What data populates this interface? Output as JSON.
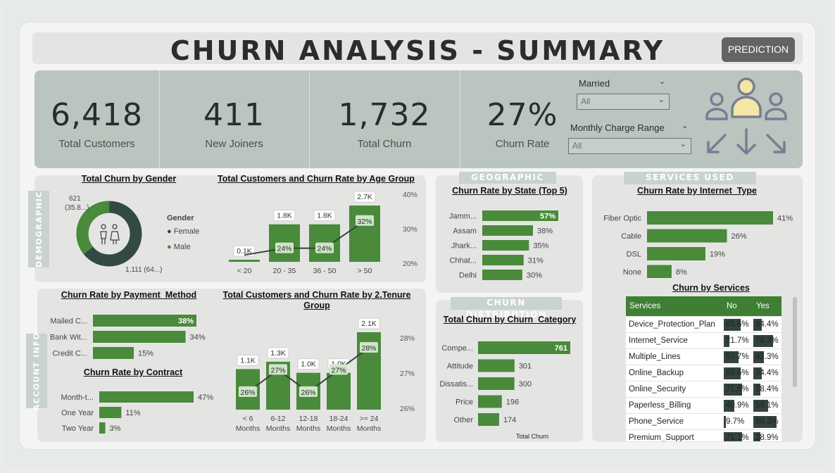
{
  "header": {
    "title": "CHURN ANALYSIS - SUMMARY",
    "prediction_label": "PREDICTION"
  },
  "kpis": [
    {
      "value": "6,418",
      "label": "Total Customers"
    },
    {
      "value": "411",
      "label": "New Joiners"
    },
    {
      "value": "1,732",
      "label": "Total Churn"
    },
    {
      "value": "27%",
      "label": "Churn Rate"
    }
  ],
  "slicers": {
    "married": {
      "label": "Married",
      "value": "All"
    },
    "charge": {
      "label": "Monthly Charge Range",
      "value": "All"
    }
  },
  "sections": {
    "demographic": "DEMOGRAPHIC",
    "account": "ACCOUNT INFO",
    "geographic": "GEOGRAPHIC",
    "distribution": "CHURN DISTRIBUTION",
    "services": "SERVICES USED"
  },
  "gender": {
    "title": "Total Churn by Gender",
    "legend_title": "Gender",
    "female_label": "Female",
    "male_label": "Male",
    "female_data_label": "1,111 (64...)",
    "male_data_label_1": "621",
    "male_data_label_2": "(35.8...)",
    "female_color": "#334a44",
    "male_color": "#4a8a3b"
  },
  "chart_data": [
    {
      "type": "pie",
      "title": "Total Churn by Gender",
      "legend": [
        "Female",
        "Male"
      ],
      "values": [
        1111,
        621
      ],
      "percent": [
        64.2,
        35.8
      ]
    },
    {
      "type": "bar",
      "title": "Total Customers and Churn Rate by Age Group",
      "categories": [
        "< 20",
        "20 - 35",
        "36 - 50",
        "> 50"
      ],
      "series": [
        {
          "values": [
            100,
            1800,
            1800,
            2700
          ],
          "labels": [
            "0.1K",
            "1.8K",
            "1.8K",
            "2.7K"
          ]
        },
        {
          "values": [
            22,
            24,
            24,
            32
          ],
          "labels": [
            "",
            "24%",
            "24%",
            "32%"
          ]
        }
      ],
      "y2_ticks": [
        "40%",
        "30%",
        "20%"
      ]
    },
    {
      "type": "bar",
      "title": "Churn Rate by Payment_Method",
      "categories": [
        "Mailed C...",
        "Bank Wit...",
        "Credit C..."
      ],
      "values": [
        38,
        34,
        15
      ],
      "labels": [
        "38%",
        "34%",
        "15%"
      ]
    },
    {
      "type": "bar",
      "title": "Churn Rate by Contract",
      "categories": [
        "Month-t...",
        "One Year",
        "Two Year"
      ],
      "values": [
        47,
        11,
        3
      ],
      "labels": [
        "47%",
        "11%",
        "3%"
      ]
    },
    {
      "type": "bar",
      "title": "Total Customers and Churn Rate by 2.Tenure Group",
      "categories": [
        "< 6 Months",
        "6-12 Months",
        "12-18 Months",
        "18-24 Months",
        ">= 24 Months"
      ],
      "series": [
        {
          "values": [
            1100,
            1300,
            1000,
            1000,
            2100
          ],
          "labels": [
            "1.1K",
            "1.3K",
            "1.0K",
            "1.0K",
            "2.1K"
          ]
        },
        {
          "values": [
            26,
            27,
            26,
            27,
            28
          ],
          "labels": [
            "26%",
            "27%",
            "26%",
            "27%",
            "28%"
          ]
        }
      ],
      "y2_ticks": [
        "28%",
        "27%",
        "26%"
      ]
    },
    {
      "type": "bar",
      "title": "Churn Rate by State (Top 5)",
      "categories": [
        "Jamm...",
        "Assam",
        "Jhark...",
        "Chhat...",
        "Delhi"
      ],
      "values": [
        57,
        38,
        35,
        31,
        30
      ],
      "labels": [
        "57%",
        "38%",
        "35%",
        "31%",
        "30%"
      ]
    },
    {
      "type": "bar",
      "title": "Total Churn by Churn_Category",
      "categories": [
        "Compe...",
        "Attitude",
        "Dissatis...",
        "Price",
        "Other"
      ],
      "values": [
        761,
        301,
        300,
        196,
        174
      ],
      "labels": [
        "761",
        "301",
        "300",
        "196",
        "174"
      ],
      "xlabel": "Total Churn"
    },
    {
      "type": "bar",
      "title": "Churn Rate by Internet_Type",
      "categories": [
        "Fiber Optic",
        "Cable",
        "DSL",
        "None"
      ],
      "values": [
        41,
        26,
        19,
        8
      ],
      "labels": [
        "41%",
        "26%",
        "19%",
        "8%"
      ]
    },
    {
      "type": "table",
      "title": "Churn by Services",
      "columns": [
        "Services",
        "No",
        "Yes"
      ],
      "rows": [
        [
          "Device_Protection_Plan",
          "65.6%",
          "34.4%"
        ],
        [
          "Internet_Service",
          "21.7%",
          "78.3%"
        ],
        [
          "Multiple_Lines",
          "57.7%",
          "42.3%"
        ],
        [
          "Online_Backup",
          "65.6%",
          "34.4%"
        ],
        [
          "Online_Security",
          "71.6%",
          "28.4%"
        ],
        [
          "Paperless_Billing",
          "40.9%",
          "59.1%"
        ],
        [
          "Phone_Service",
          "9.7%",
          "90.3%"
        ],
        [
          "Premium_Support",
          "71.1%",
          "28.9%"
        ]
      ]
    }
  ]
}
